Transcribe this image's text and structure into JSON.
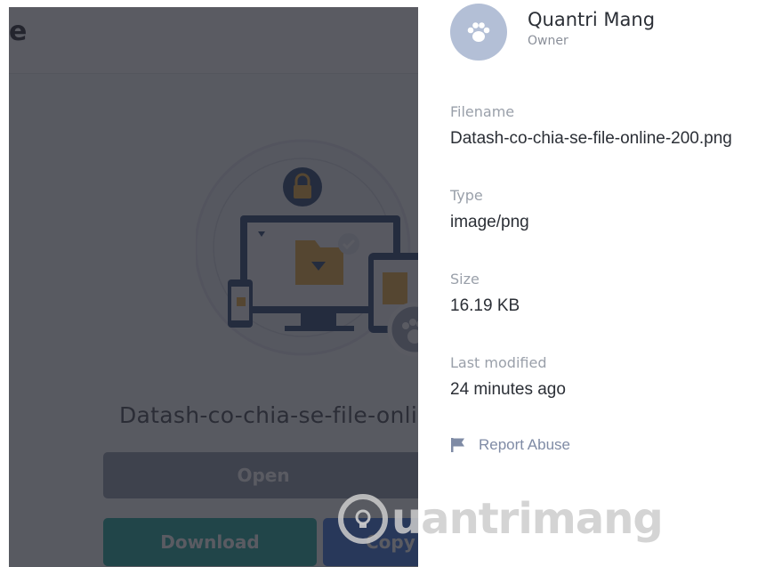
{
  "background_page": {
    "title_fragment": "e",
    "filename_truncated": "Datash-co-chia-se-file-onlin",
    "buttons": {
      "open": "Open",
      "download": "Download",
      "copy": "Copy"
    }
  },
  "panel": {
    "owner": {
      "name": "Quantri Mang",
      "role": "Owner",
      "avatar_icon": "paw-icon"
    },
    "fields": [
      {
        "label": "Filename",
        "value": "Datash-co-chia-se-file-online-200.png"
      },
      {
        "label": "Type",
        "value": "image/png"
      },
      {
        "label": "Size",
        "value": "16.19 KB"
      },
      {
        "label": "Last modified",
        "value": "24 minutes ago"
      }
    ],
    "report_link": {
      "label": "Report Abuse",
      "icon": "flag-icon"
    }
  },
  "watermark": {
    "text": "uantrimang"
  },
  "colors": {
    "avatar": "#b3bfd6",
    "download_button": "#13a596",
    "copy_button": "#2e6cdc",
    "open_button": "#8c95a8",
    "report_link": "#7f8ba5"
  }
}
